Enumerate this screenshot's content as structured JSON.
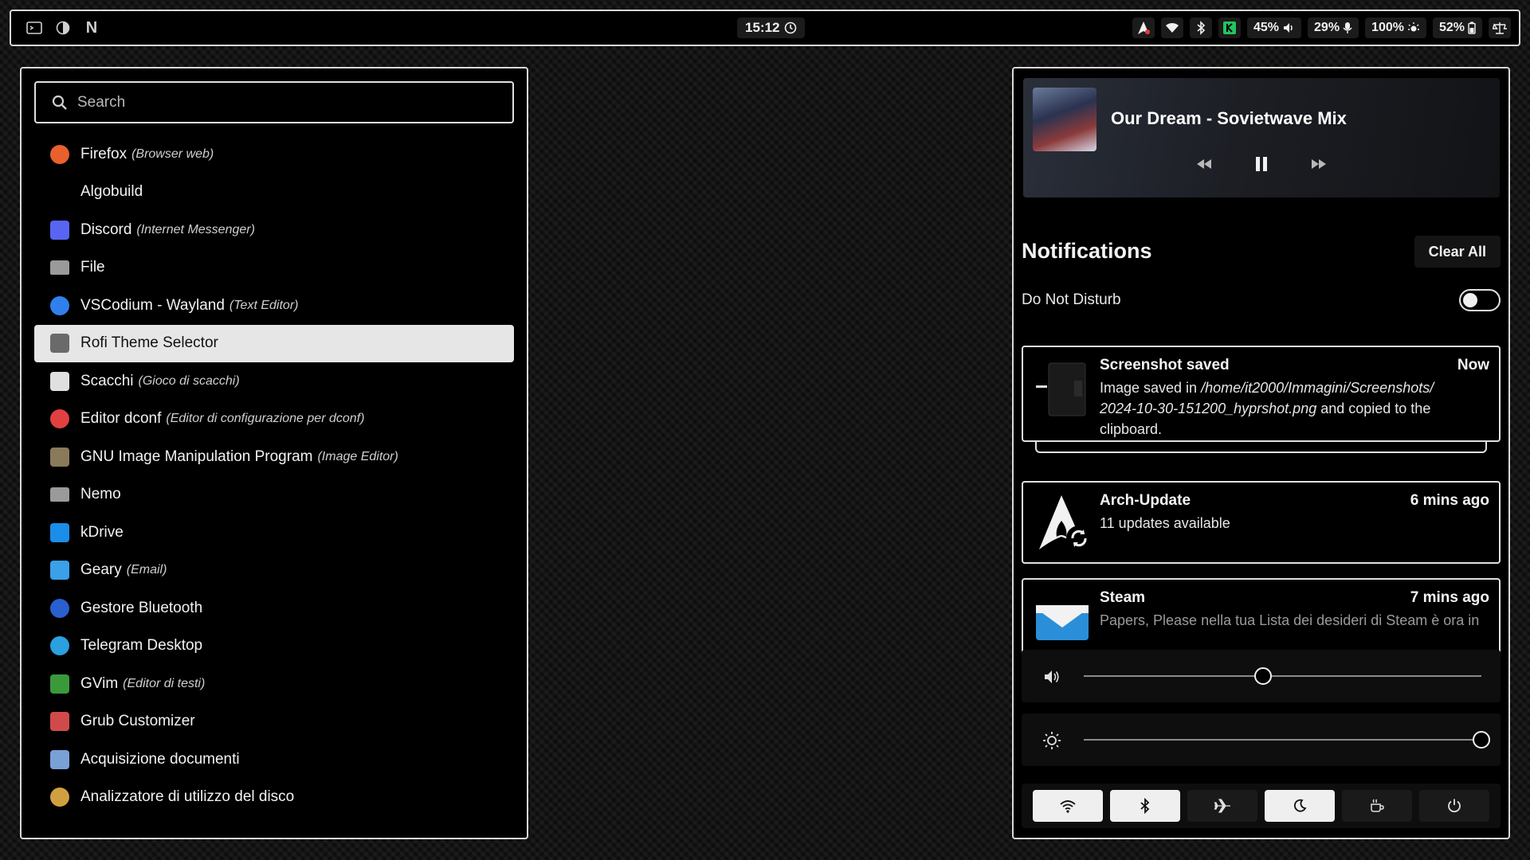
{
  "topbar": {
    "clock": "15:12",
    "volume": "45%",
    "mic": "29%",
    "brightness": "100%",
    "battery": "52%",
    "left_icons": [
      "terminal-icon",
      "half-circle-icon",
      "n-logo-icon"
    ],
    "right_icons": [
      "arch-update-icon",
      "wifi-icon",
      "bluetooth-icon",
      "kdrive-tray-icon",
      "volume-icon",
      "microphone-icon",
      "brightness-icon",
      "battery-icon",
      "scale-icon"
    ],
    "n_letter": "N"
  },
  "launcher": {
    "search_placeholder": "Search",
    "selected_index": 5,
    "apps": [
      {
        "name": "Firefox",
        "desc": "(Browser web)",
        "icon": "firefox-icon",
        "color": "#e8612c"
      },
      {
        "name": "Algobuild",
        "desc": "",
        "icon": "",
        "color": ""
      },
      {
        "name": "Discord",
        "desc": "(Internet Messenger)",
        "icon": "discord-icon",
        "color": "#5865f2"
      },
      {
        "name": "File",
        "desc": "",
        "icon": "folder-icon",
        "color": "#9a9a9a"
      },
      {
        "name": "VSCodium - Wayland",
        "desc": "(Text Editor)",
        "icon": "vscodium-icon",
        "color": "#2f80ed"
      },
      {
        "name": "Rofi Theme Selector",
        "desc": "",
        "icon": "rofi-icon",
        "color": "#6a6a6a"
      },
      {
        "name": "Scacchi",
        "desc": "(Gioco di scacchi)",
        "icon": "chess-icon",
        "color": "#e0e0e0"
      },
      {
        "name": "Editor dconf",
        "desc": "(Editor di configurazione per dconf)",
        "icon": "dconf-icon",
        "color": "#e04040"
      },
      {
        "name": "GNU Image Manipulation Program",
        "desc": "(Image Editor)",
        "icon": "gimp-icon",
        "color": "#8a7a5a"
      },
      {
        "name": "Nemo",
        "desc": "",
        "icon": "folder-icon",
        "color": "#9a9a9a"
      },
      {
        "name": "kDrive",
        "desc": "",
        "icon": "kdrive-icon",
        "color": "#1a8ee8"
      },
      {
        "name": "Geary",
        "desc": "(Email)",
        "icon": "mail-icon",
        "color": "#3aa0e8"
      },
      {
        "name": "Gestore Bluetooth",
        "desc": "",
        "icon": "bluetooth-icon",
        "color": "#2a5fcf"
      },
      {
        "name": "Telegram Desktop",
        "desc": "",
        "icon": "telegram-icon",
        "color": "#2aa0e0"
      },
      {
        "name": "GVim",
        "desc": "(Editor di testi)",
        "icon": "vim-icon",
        "color": "#3a9a3a"
      },
      {
        "name": "Grub Customizer",
        "desc": "",
        "icon": "grub-icon",
        "color": "#d04a4a"
      },
      {
        "name": "Acquisizione documenti",
        "desc": "",
        "icon": "scanner-icon",
        "color": "#7aa0d8"
      },
      {
        "name": "Analizzatore di utilizzo del disco",
        "desc": "",
        "icon": "disk-usage-icon",
        "color": "#d0a040"
      }
    ]
  },
  "player": {
    "track": "Our Dream - Sovietwave Mix",
    "state": "playing"
  },
  "notifications": {
    "heading": "Notifications",
    "clear_label": "Clear All",
    "dnd_label": "Do Not Disturb",
    "dnd_on": false,
    "items": [
      {
        "title": "Screenshot saved",
        "time": "Now",
        "body_prefix": "Image saved in ",
        "body_path": "/home/it2000/Immagini/Screenshots/ 2024-10-30-151200_hyprshot.png",
        "body_suffix": " and copied to the clipboard.",
        "icon": "screenshot-thumbnail-icon"
      },
      {
        "title": "Arch-Update",
        "time": "6 mins ago",
        "body": "11 updates available",
        "icon": "arch-update-icon"
      },
      {
        "title": "Steam",
        "time": "7 mins ago",
        "body": "Papers, Please nella tua Lista dei desideri di Steam è ora in",
        "icon": "steam-mail-icon"
      }
    ]
  },
  "sliders": {
    "volume_fraction": 0.45,
    "brightness_fraction": 1.0
  },
  "quick_settings": [
    {
      "name": "wifi-toggle",
      "icon": "wifi-icon",
      "on": true
    },
    {
      "name": "bluetooth-toggle",
      "icon": "bluetooth-icon",
      "on": true
    },
    {
      "name": "airplane-toggle",
      "icon": "airplane-icon",
      "on": false
    },
    {
      "name": "night-light-toggle",
      "icon": "moon-icon",
      "on": true
    },
    {
      "name": "caffeine-toggle",
      "icon": "coffee-icon",
      "on": false
    },
    {
      "name": "power-button",
      "icon": "power-icon",
      "on": false
    }
  ]
}
